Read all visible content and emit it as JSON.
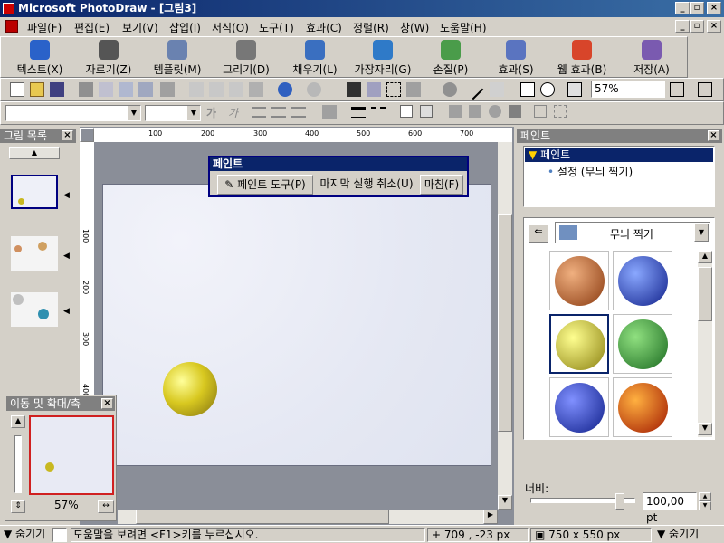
{
  "window": {
    "title": "Microsoft PhotoDraw - [그림3]",
    "min": "_",
    "max": "▫",
    "close": "×"
  },
  "menu": [
    "파일(F)",
    "편집(E)",
    "보기(V)",
    "삽입(I)",
    "서식(O)",
    "도구(T)",
    "효과(C)",
    "정렬(R)",
    "창(W)",
    "도움말(H)"
  ],
  "big_toolbar": [
    {
      "label": "텍스트(X)",
      "icon": "text-icon",
      "color": "#2a62c9"
    },
    {
      "label": "자르기(Z)",
      "icon": "scissors-icon",
      "color": "#555555"
    },
    {
      "label": "템플릿(M)",
      "icon": "template-icon",
      "color": "#6a82b0"
    },
    {
      "label": "그리기(D)",
      "icon": "pen-icon",
      "color": "#777777"
    },
    {
      "label": "채우기(L)",
      "icon": "fill-bucket-icon",
      "color": "#3a6fc0"
    },
    {
      "label": "가장자리(G)",
      "icon": "edge-icon",
      "color": "#2f7ac8"
    },
    {
      "label": "손질(P)",
      "icon": "retouch-icon",
      "color": "#4a9c4a"
    },
    {
      "label": "효과(S)",
      "icon": "effects-icon",
      "color": "#5a74c0"
    },
    {
      "label": "웹 효과(B)",
      "icon": "web-effects-icon",
      "color": "#d8452a"
    },
    {
      "label": "저장(A)",
      "icon": "save-icon",
      "color": "#7a5ab0"
    }
  ],
  "zoom": "57%",
  "ruler_h": [
    "100",
    "200",
    "300",
    "400",
    "500",
    "600",
    "700"
  ],
  "ruler_v": [
    "100",
    "200",
    "300",
    "400"
  ],
  "left_panel": {
    "title": "그림 목록"
  },
  "paint_dialog": {
    "title": "페인트",
    "paint_tool": "페인트 도구(P)",
    "undo_last": "마지막 실행 취소(U)",
    "finish": "마침(F)"
  },
  "nav_panel": {
    "title": "이동 및 확대/축",
    "zoom": "57%"
  },
  "right_panel": {
    "title": "페인트",
    "tree_root": "페인트",
    "tree_child": "설정 (무늬 찍기)",
    "gallery_select": "무늬 찍기",
    "swatches": [
      {
        "name": "copper-sphere",
        "c1": "#f0b080",
        "c2": "#8a3a10"
      },
      {
        "name": "blue-dotted-sphere",
        "c1": "#8aa8ff",
        "c2": "#10208a"
      },
      {
        "name": "yellow-sphere",
        "c1": "#ffff90",
        "c2": "#8a8010"
      },
      {
        "name": "green-sphere",
        "c1": "#90e080",
        "c2": "#1a6a20"
      },
      {
        "name": "blue-sphere",
        "c1": "#8090ff",
        "c2": "#10208a"
      },
      {
        "name": "orange-sphere",
        "c1": "#ffb040",
        "c2": "#a01800"
      }
    ],
    "width_label": "너비:",
    "width_value": "100,00 pt"
  },
  "status": {
    "hide_left": "숨기기",
    "help": "도움말을 보려면 <F1>키를 누르십시오.",
    "coords": "709 , -23  px",
    "size": "750 x 550  px",
    "hide_right": "숨기기"
  }
}
